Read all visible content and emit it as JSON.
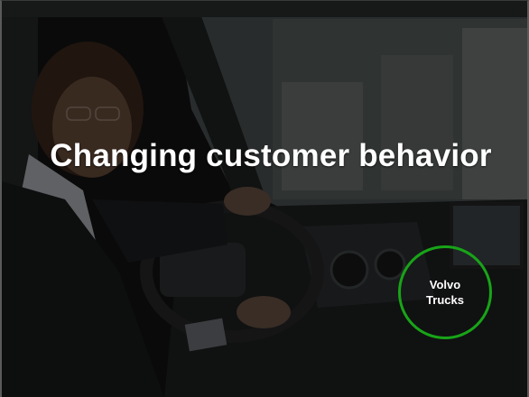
{
  "slide": {
    "title": "Changing customer behavior",
    "badge": {
      "line1": "Volvo",
      "line2": "Trucks",
      "ring_color": "#18a418"
    }
  },
  "colors": {
    "text": "#ffffff",
    "background": "#0b0b0b"
  }
}
